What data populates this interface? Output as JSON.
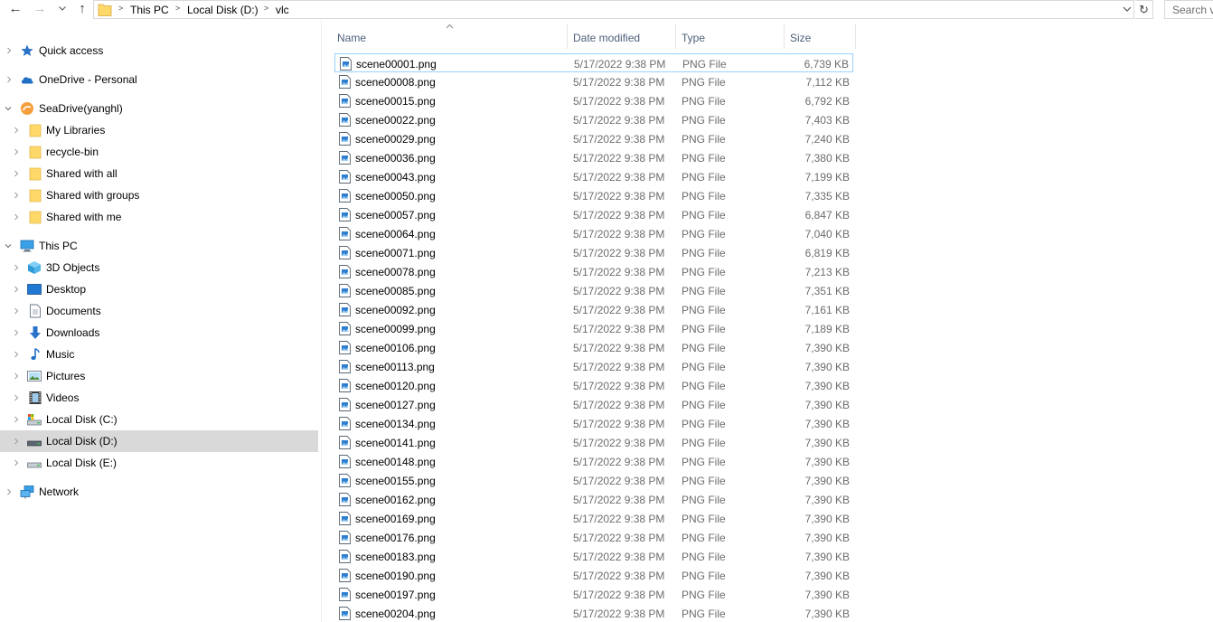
{
  "toolbar": {
    "back_icon": "back-arrow-icon",
    "forward_icon": "forward-arrow-icon",
    "recent_icon": "chevron-down-icon",
    "up_icon": "up-arrow-icon",
    "up_glyph": "↑",
    "back_glyph": "←",
    "forward_glyph": "→",
    "refresh_glyph": "↻"
  },
  "address": {
    "crumbs": [
      "This PC",
      "Local Disk (D:)",
      "vlc"
    ],
    "separator": ">"
  },
  "search": {
    "placeholder": "Search vlc"
  },
  "nav": {
    "items": [
      {
        "label": "Quick access",
        "icon": "star-icon"
      },
      {
        "label": "OneDrive - Personal",
        "icon": "cloud-icon"
      },
      {
        "label": "SeaDrive(yanghl)",
        "icon": "seadrive-icon"
      },
      {
        "label": "My Libraries",
        "icon": "folder-icon"
      },
      {
        "label": "recycle-bin",
        "icon": "folder-icon"
      },
      {
        "label": "Shared with all",
        "icon": "folder-icon"
      },
      {
        "label": "Shared with groups",
        "icon": "folder-icon"
      },
      {
        "label": "Shared with me",
        "icon": "folder-icon"
      },
      {
        "label": "This PC",
        "icon": "computer-icon"
      },
      {
        "label": "3D Objects",
        "icon": "cube-icon"
      },
      {
        "label": "Desktop",
        "icon": "desktop-icon"
      },
      {
        "label": "Documents",
        "icon": "document-icon"
      },
      {
        "label": "Downloads",
        "icon": "download-icon"
      },
      {
        "label": "Music",
        "icon": "music-note-icon"
      },
      {
        "label": "Pictures",
        "icon": "picture-icon"
      },
      {
        "label": "Videos",
        "icon": "film-icon"
      },
      {
        "label": "Local Disk (C:)",
        "icon": "system-drive-icon"
      },
      {
        "label": "Local Disk (D:)",
        "icon": "drive-icon",
        "selected": true
      },
      {
        "label": "Local Disk (E:)",
        "icon": "drive-icon"
      },
      {
        "label": "Network",
        "icon": "network-icon"
      }
    ]
  },
  "columns": {
    "name": "Name",
    "date": "Date modified",
    "type": "Type",
    "size": "Size"
  },
  "files": [
    {
      "name": "scene00001.png",
      "date": "5/17/2022 9:38 PM",
      "type": "PNG File",
      "size": "6,739 KB"
    },
    {
      "name": "scene00008.png",
      "date": "5/17/2022 9:38 PM",
      "type": "PNG File",
      "size": "7,112 KB"
    },
    {
      "name": "scene00015.png",
      "date": "5/17/2022 9:38 PM",
      "type": "PNG File",
      "size": "6,792 KB"
    },
    {
      "name": "scene00022.png",
      "date": "5/17/2022 9:38 PM",
      "type": "PNG File",
      "size": "7,403 KB"
    },
    {
      "name": "scene00029.png",
      "date": "5/17/2022 9:38 PM",
      "type": "PNG File",
      "size": "7,240 KB"
    },
    {
      "name": "scene00036.png",
      "date": "5/17/2022 9:38 PM",
      "type": "PNG File",
      "size": "7,380 KB"
    },
    {
      "name": "scene00043.png",
      "date": "5/17/2022 9:38 PM",
      "type": "PNG File",
      "size": "7,199 KB"
    },
    {
      "name": "scene00050.png",
      "date": "5/17/2022 9:38 PM",
      "type": "PNG File",
      "size": "7,335 KB"
    },
    {
      "name": "scene00057.png",
      "date": "5/17/2022 9:38 PM",
      "type": "PNG File",
      "size": "6,847 KB"
    },
    {
      "name": "scene00064.png",
      "date": "5/17/2022 9:38 PM",
      "type": "PNG File",
      "size": "7,040 KB"
    },
    {
      "name": "scene00071.png",
      "date": "5/17/2022 9:38 PM",
      "type": "PNG File",
      "size": "6,819 KB"
    },
    {
      "name": "scene00078.png",
      "date": "5/17/2022 9:38 PM",
      "type": "PNG File",
      "size": "7,213 KB"
    },
    {
      "name": "scene00085.png",
      "date": "5/17/2022 9:38 PM",
      "type": "PNG File",
      "size": "7,351 KB"
    },
    {
      "name": "scene00092.png",
      "date": "5/17/2022 9:38 PM",
      "type": "PNG File",
      "size": "7,161 KB"
    },
    {
      "name": "scene00099.png",
      "date": "5/17/2022 9:38 PM",
      "type": "PNG File",
      "size": "7,189 KB"
    },
    {
      "name": "scene00106.png",
      "date": "5/17/2022 9:38 PM",
      "type": "PNG File",
      "size": "7,390 KB"
    },
    {
      "name": "scene00113.png",
      "date": "5/17/2022 9:38 PM",
      "type": "PNG File",
      "size": "7,390 KB"
    },
    {
      "name": "scene00120.png",
      "date": "5/17/2022 9:38 PM",
      "type": "PNG File",
      "size": "7,390 KB"
    },
    {
      "name": "scene00127.png",
      "date": "5/17/2022 9:38 PM",
      "type": "PNG File",
      "size": "7,390 KB"
    },
    {
      "name": "scene00134.png",
      "date": "5/17/2022 9:38 PM",
      "type": "PNG File",
      "size": "7,390 KB"
    },
    {
      "name": "scene00141.png",
      "date": "5/17/2022 9:38 PM",
      "type": "PNG File",
      "size": "7,390 KB"
    },
    {
      "name": "scene00148.png",
      "date": "5/17/2022 9:38 PM",
      "type": "PNG File",
      "size": "7,390 KB"
    },
    {
      "name": "scene00155.png",
      "date": "5/17/2022 9:38 PM",
      "type": "PNG File",
      "size": "7,390 KB"
    },
    {
      "name": "scene00162.png",
      "date": "5/17/2022 9:38 PM",
      "type": "PNG File",
      "size": "7,390 KB"
    },
    {
      "name": "scene00169.png",
      "date": "5/17/2022 9:38 PM",
      "type": "PNG File",
      "size": "7,390 KB"
    },
    {
      "name": "scene00176.png",
      "date": "5/17/2022 9:38 PM",
      "type": "PNG File",
      "size": "7,390 KB"
    },
    {
      "name": "scene00183.png",
      "date": "5/17/2022 9:38 PM",
      "type": "PNG File",
      "size": "7,390 KB"
    },
    {
      "name": "scene00190.png",
      "date": "5/17/2022 9:38 PM",
      "type": "PNG File",
      "size": "7,390 KB"
    },
    {
      "name": "scene00197.png",
      "date": "5/17/2022 9:38 PM",
      "type": "PNG File",
      "size": "7,390 KB"
    },
    {
      "name": "scene00204.png",
      "date": "5/17/2022 9:38 PM",
      "type": "PNG File",
      "size": "7,390 KB"
    }
  ],
  "colors": {
    "selection": "#d9d9d9",
    "focus_border": "#99d1ff",
    "header_text": "#4c607a",
    "muted_text": "#6d6d6d",
    "folder": "#ffd86a"
  }
}
